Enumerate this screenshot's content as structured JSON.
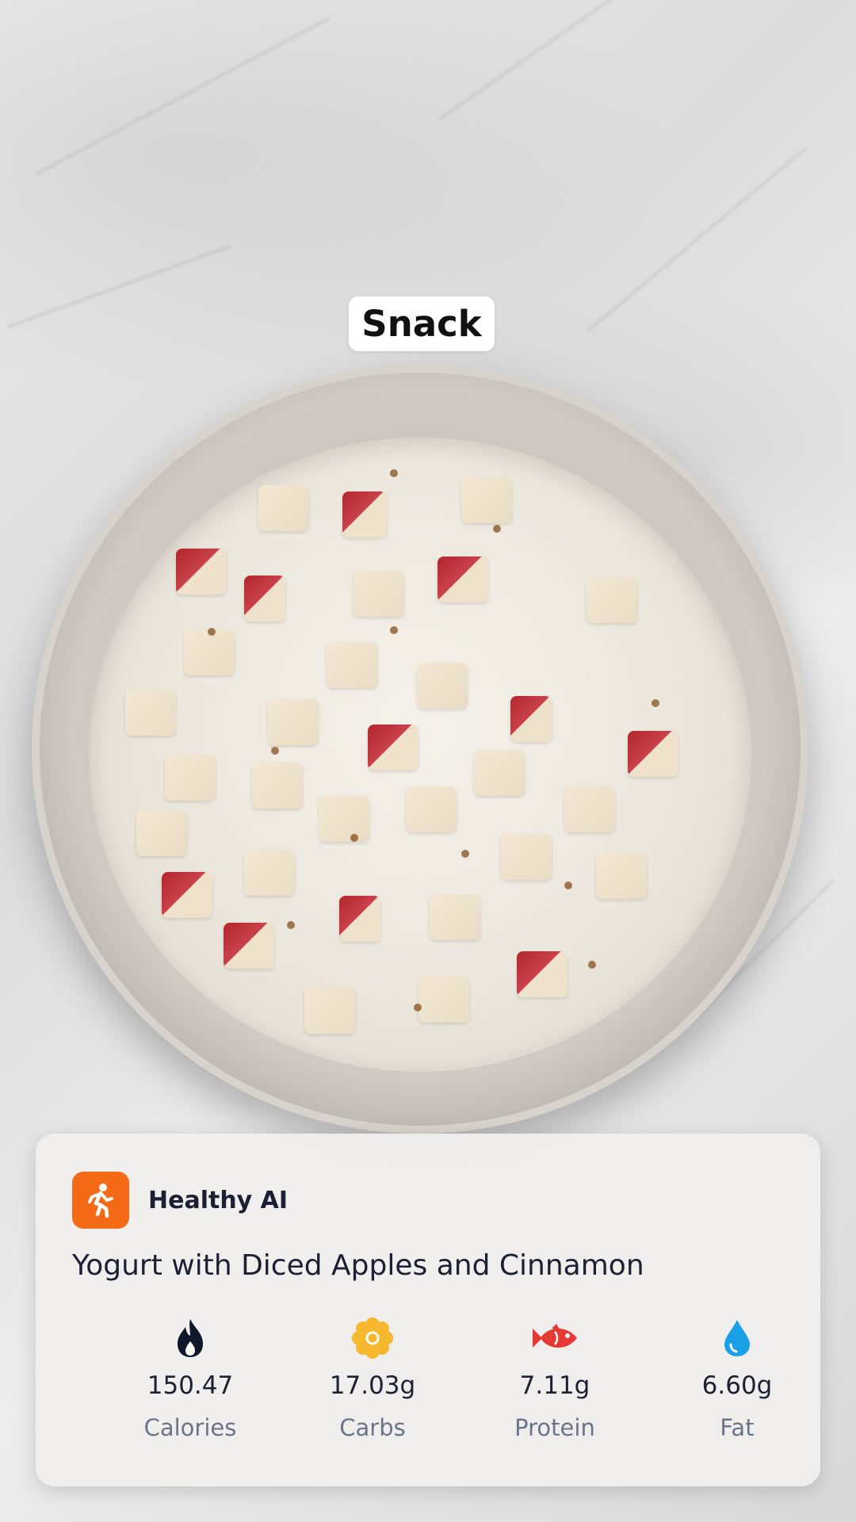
{
  "photo": {
    "meal_tag": "Snack"
  },
  "card": {
    "app_name": "Healthy AI",
    "app_icon": "running-person-icon",
    "accent_color": "#f56a16",
    "food_name": "Yogurt with Diced Apples and Cinnamon",
    "nutrients": [
      {
        "icon": "flame-icon",
        "value": "150.47",
        "label": "Calories",
        "color": "#0f172a"
      },
      {
        "icon": "flower-icon",
        "value": "17.03g",
        "label": "Carbs",
        "color": "#f5b82e"
      },
      {
        "icon": "fish-icon",
        "value": "7.11g",
        "label": "Protein",
        "color": "#e53935"
      },
      {
        "icon": "drop-icon",
        "value": "6.60g",
        "label": "Fat",
        "color": "#1aa0e6"
      }
    ]
  }
}
